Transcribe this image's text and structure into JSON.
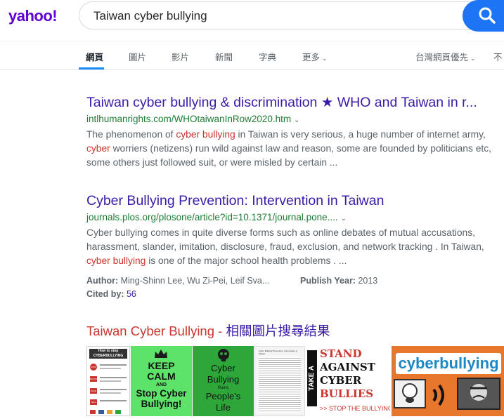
{
  "header": {
    "logo": "yahoo!",
    "search_value": "Taiwan cyber bullying"
  },
  "nav": {
    "tabs": [
      "網頁",
      "圖片",
      "影片",
      "新聞",
      "字典",
      "更多"
    ],
    "region": "台灣網頁優先",
    "extra": "不"
  },
  "results": [
    {
      "title": "Taiwan cyber bullying & discrimination ★ WHO and Taiwan in r...",
      "url": "intlhumanrights.com/WHOtaiwanInRow2020.htm",
      "snippet_parts": [
        "The phenomenon of ",
        "cyber bullying",
        " in Taiwan is very serious, a huge number of internet army, ",
        "cyber",
        " worriers (netizens) run wild against law and reason, some are founded by politicians etc, some others just followed suit, or were misled by certain ..."
      ]
    },
    {
      "title": "Cyber Bullying Prevention: Intervention in Taiwan",
      "url": "journals.plos.org/plosone/article?id=10.1371/journal.pone....",
      "snippet_parts": [
        "Cyber bullying comes in quite diverse forms such as online debates of mutual accusations, harassment, slander, imitation, disclosure, fraud, exclusion, and network tracking . In Taiwan, ",
        "cyber bullying",
        " is one of the major school health problems . ..."
      ],
      "author_label": "Author:",
      "author_value": "Ming-Shinn Lee, Wu Zi-Pei, Leif Sva...",
      "year_label": "Publish Year:",
      "year_value": "2013",
      "cited_label": "Cited by:",
      "cited_value": "56"
    }
  ],
  "images": {
    "heading_main": "Taiwan Cyber Bullying",
    "heading_sep": " - ",
    "heading_sub": "相關圖片搜尋結果",
    "thumb1": {
      "title": "How to stop CYBERBULLYING",
      "rows": [
        "STOP",
        "BLOCK",
        "SAVE",
        "TELL"
      ]
    },
    "thumb2": {
      "text": [
        "KEEP",
        "CALM",
        "AND",
        "Stop Cyber",
        "Bullying!"
      ]
    },
    "thumb3": {
      "text": [
        "Cyber",
        "Bullying",
        "Ruins",
        "People's",
        "Life"
      ]
    },
    "thumb4": {
      "title": "Cyber Bullying Prevention: Intervention in Taiwan"
    },
    "thumb5": {
      "side": "TAKE A",
      "lines": [
        "STAND",
        "AGAINST",
        "CYBER",
        "BULLIES"
      ],
      "footer": ">> STOP THE BULLYING"
    },
    "thumb6": {
      "text": "cyberbullying"
    },
    "colors": {
      "keep_calm_bg": "#5ee36a",
      "ruins_bg": "#2ea63a",
      "bullies_red": "#c9362f",
      "cyberbullying_bg": "#e8772e"
    }
  }
}
